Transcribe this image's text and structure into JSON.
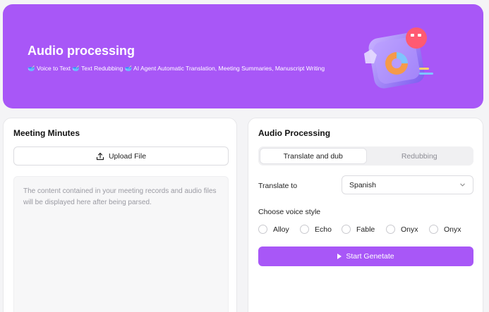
{
  "hero": {
    "title": "Audio processing",
    "subtitle": "🥣 Voice to Text 🥣 Text Redubbing 🥣 AI Agent Automatic Translation, Meeting Summaries, Manuscript Writing",
    "color": "#a857f7"
  },
  "minutes": {
    "title": "Meeting Minutes",
    "upload_label": "Upload File",
    "placeholder": "The content contained in your meeting records and audio files will be displayed here after being parsed."
  },
  "processing": {
    "title": "Audio Processing",
    "tabs": [
      {
        "label": "Translate and dub",
        "active": true
      },
      {
        "label": "Redubbing",
        "active": false
      }
    ],
    "translate_label": "Translate to",
    "translate_value": "Spanish",
    "voice_label": "Choose voice style",
    "voices": [
      "Alloy",
      "Echo",
      "Fable",
      "Onyx",
      "Onyx"
    ],
    "start_label": "Start Genetate"
  },
  "icons": {
    "upload": "upload-icon",
    "chevron": "chevron-down-icon",
    "play": "play-icon"
  }
}
